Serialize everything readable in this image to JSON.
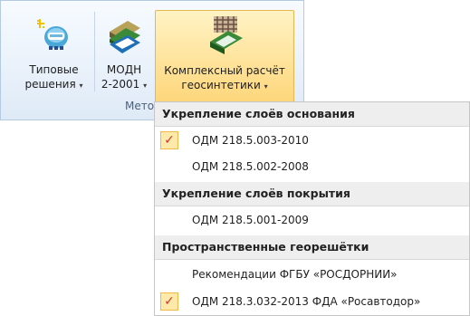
{
  "ribbon": {
    "group_label": "Мето",
    "buttons": [
      {
        "line1": "Типовые",
        "line2": "решения",
        "arrow": "▾",
        "icon": "typical-solutions-icon"
      },
      {
        "line1": "МОДН",
        "line2": "2-2001",
        "arrow": "▾",
        "icon": "books-icon"
      },
      {
        "line1": "Комплексный расчёт",
        "line2": "геосинтетики",
        "arrow": "▾",
        "icon": "geosynthetics-book-icon"
      }
    ]
  },
  "menu": {
    "sections": [
      {
        "header": "Укрепление слоёв основания",
        "items": [
          {
            "label": "ОДМ 218.5.003-2010",
            "checked": true
          },
          {
            "label": "ОДМ 218.5.002-2008",
            "checked": false
          }
        ]
      },
      {
        "header": "Укрепление слоёв покрытия",
        "items": [
          {
            "label": "ОДМ 218.5.001-2009",
            "checked": false
          }
        ]
      },
      {
        "header": "Пространственные георешётки",
        "items": [
          {
            "label": "Рекомендации ФГБУ «РОСДОРНИИ»",
            "checked": false
          },
          {
            "label": "ОДМ 218.3.032-2013 ФДА «Росавтодор»",
            "checked": true
          }
        ]
      }
    ],
    "check_glyph": "✓"
  },
  "colors": {
    "ribbon_bg": "#dfeaf7",
    "active_button": "#fed67a",
    "check_mark": "#d0372c"
  }
}
